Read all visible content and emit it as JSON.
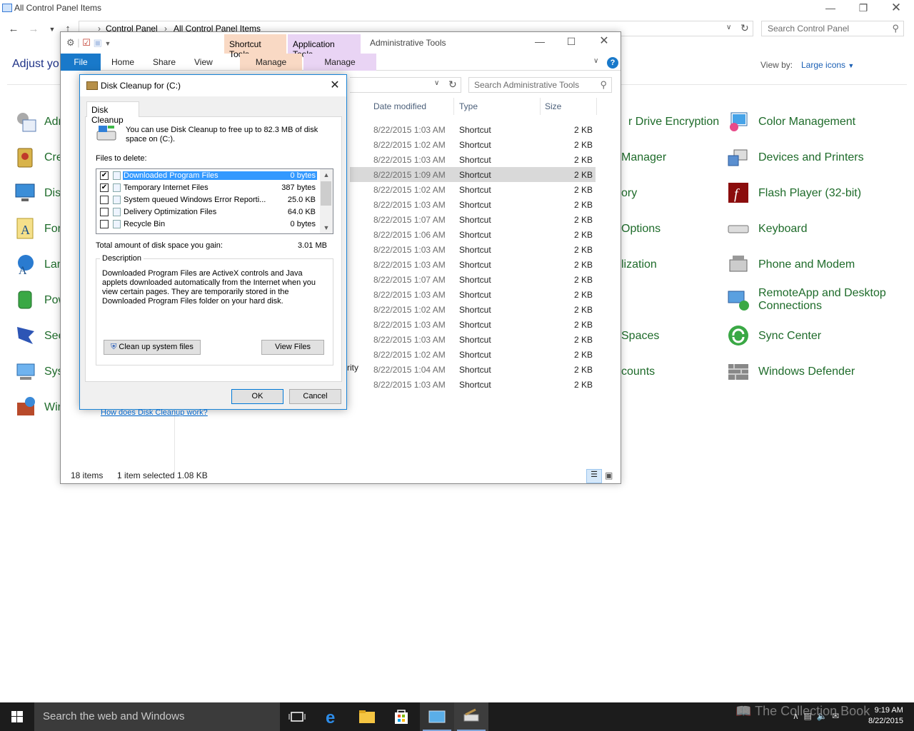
{
  "control_panel": {
    "title": "All Control Panel Items",
    "breadcrumb": [
      "Control Panel",
      "All Control Panel Items"
    ],
    "search_placeholder": "Search Control Panel",
    "adjust_partial": "Adjust yo",
    "view_by_label": "View by:",
    "view_by_value": "Large icons",
    "left_items": [
      "Adr",
      "Cre",
      "Dis",
      "For",
      "Lan",
      "Pow",
      "Sec",
      "Sys",
      "Wir"
    ],
    "middle_items": [
      "r Drive Encryption",
      "Manager",
      "ory",
      "Options",
      "lization",
      "Spaces",
      "counts"
    ],
    "right_items": [
      "Color Management",
      "Devices and Printers",
      "Flash Player (32-bit)",
      "Keyboard",
      "Phone and Modem",
      "RemoteApp and Desktop",
      "Connections",
      "Sync Center",
      "Windows Defender"
    ]
  },
  "admin_tools": {
    "title": "Administrative Tools",
    "contextual_tabs": [
      "Shortcut Tools",
      "Application Tools"
    ],
    "ribbon_tabs": [
      "File",
      "Home",
      "Share",
      "View",
      "Manage",
      "Manage"
    ],
    "search_placeholder": "Search Administrative Tools",
    "columns": [
      "Date modified",
      "Type",
      "Size"
    ],
    "rows": [
      {
        "date": "8/22/2015 1:03 AM",
        "type": "Shortcut",
        "size": "2 KB"
      },
      {
        "date": "8/22/2015 1:02 AM",
        "type": "Shortcut",
        "size": "2 KB"
      },
      {
        "date": "8/22/2015 1:03 AM",
        "type": "Shortcut",
        "size": "2 KB"
      },
      {
        "date": "8/22/2015 1:09 AM",
        "type": "Shortcut",
        "size": "2 KB"
      },
      {
        "date": "8/22/2015 1:02 AM",
        "type": "Shortcut",
        "size": "2 KB"
      },
      {
        "date": "8/22/2015 1:03 AM",
        "type": "Shortcut",
        "size": "2 KB"
      },
      {
        "date": "8/22/2015 1:07 AM",
        "type": "Shortcut",
        "size": "2 KB"
      },
      {
        "date": "8/22/2015 1:06 AM",
        "type": "Shortcut",
        "size": "2 KB"
      },
      {
        "date": "8/22/2015 1:03 AM",
        "type": "Shortcut",
        "size": "2 KB"
      },
      {
        "date": "8/22/2015 1:03 AM",
        "type": "Shortcut",
        "size": "2 KB"
      },
      {
        "date": "8/22/2015 1:07 AM",
        "type": "Shortcut",
        "size": "2 KB"
      },
      {
        "date": "8/22/2015 1:03 AM",
        "type": "Shortcut",
        "size": "2 KB"
      },
      {
        "date": "8/22/2015 1:02 AM",
        "type": "Shortcut",
        "size": "2 KB"
      },
      {
        "date": "8/22/2015 1:03 AM",
        "type": "Shortcut",
        "size": "2 KB"
      },
      {
        "date": "8/22/2015 1:03 AM",
        "type": "Shortcut",
        "size": "2 KB"
      },
      {
        "date": "8/22/2015 1:02 AM",
        "type": "Shortcut",
        "size": "2 KB"
      },
      {
        "date": "8/22/2015 1:04 AM",
        "type": "Shortcut",
        "size": "2 KB"
      },
      {
        "date": "8/22/2015 1:03 AM",
        "type": "Shortcut",
        "size": "2 KB"
      }
    ],
    "selected_row": 3,
    "partial_name": "rity",
    "status_items": "18 items",
    "status_selected": "1 item selected  1.08 KB"
  },
  "disk_cleanup": {
    "title": "Disk Cleanup for  (C:)",
    "tab": "Disk Cleanup",
    "intro": "You can use Disk Cleanup to free up to 82.3 MB of disk space on  (C:).",
    "files_to_delete_label": "Files to delete:",
    "files": [
      {
        "name": "Downloaded Program Files",
        "size": "0 bytes",
        "checked": true
      },
      {
        "name": "Temporary Internet Files",
        "size": "387 bytes",
        "checked": true
      },
      {
        "name": "System queued Windows Error Reporti...",
        "size": "25.0 KB",
        "checked": false
      },
      {
        "name": "Delivery Optimization Files",
        "size": "64.0 KB",
        "checked": false
      },
      {
        "name": "Recycle Bin",
        "size": "0 bytes",
        "checked": false
      }
    ],
    "total_label": "Total amount of disk space you gain:",
    "total_value": "3.01 MB",
    "description_label": "Description",
    "description_text": "Downloaded Program Files are ActiveX controls and Java applets downloaded automatically from the Internet when you view certain pages. They are temporarily stored in the Downloaded Program Files folder on your hard disk.",
    "cleanup_system_button": "Clean up system files",
    "view_files_button": "View Files",
    "help_link": "How does Disk Cleanup work?",
    "ok_button": "OK",
    "cancel_button": "Cancel"
  },
  "taskbar": {
    "search_placeholder": "Search the web and Windows",
    "time": "9:19 AM",
    "date": "8/22/2015"
  },
  "watermark": "The Collection Book",
  "colors": {
    "accent": "#1979ca",
    "cp_link_green": "#1e6b2a",
    "shortcut_tools": "#f9d9c4",
    "application_tools": "#e9d4f4",
    "taskbar": "#1c1c1c"
  }
}
